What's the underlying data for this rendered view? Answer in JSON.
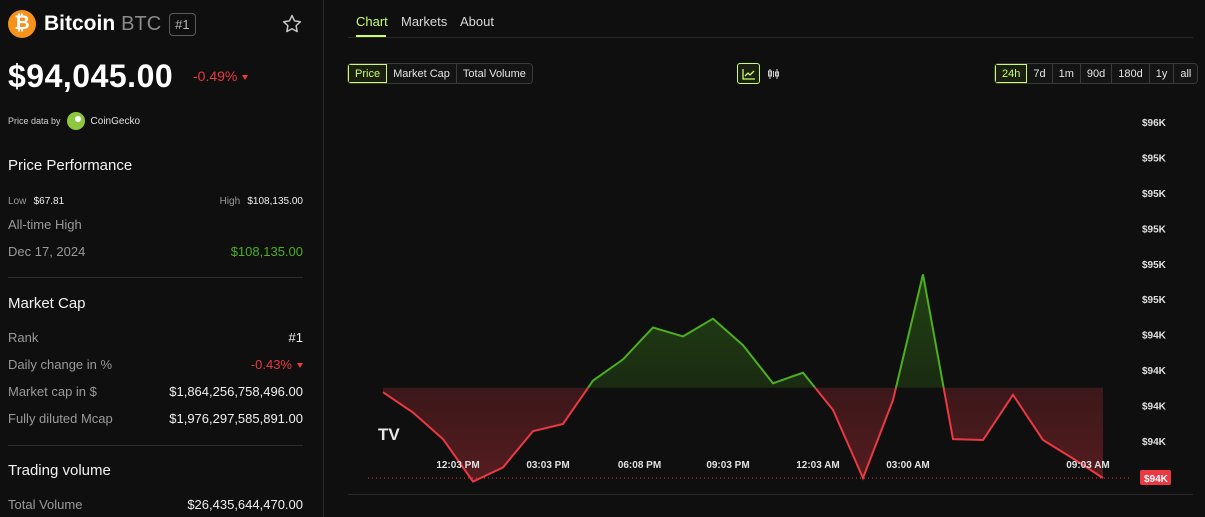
{
  "coin": {
    "logo_glyph": "₿",
    "name": "Bitcoin",
    "symbol": "BTC",
    "rank_badge": "#1",
    "price": "$94,045.00",
    "change": "-0.49%",
    "price_data_by": "Price data by",
    "source": "CoinGecko"
  },
  "performance": {
    "title": "Price Performance",
    "low_label": "Low",
    "low_value": "$67.81",
    "high_label": "High",
    "high_value": "$108,135.00",
    "ath_label": "All-time High",
    "ath_date": "Dec 17, 2024",
    "ath_value": "$108,135.00"
  },
  "market_cap": {
    "title": "Market Cap",
    "rows": [
      {
        "label": "Rank",
        "value": "#1"
      },
      {
        "label": "Daily change in %",
        "value": "-0.43%"
      },
      {
        "label": "Market cap in $",
        "value": "$1,864,256,758,496.00"
      },
      {
        "label": "Fully diluted Mcap",
        "value": "$1,976,297,585,891.00"
      }
    ]
  },
  "trading": {
    "title": "Trading volume",
    "rows": [
      {
        "label": "Total Volume",
        "value": "$26,435,644,470.00"
      }
    ]
  },
  "tabs": [
    "Chart",
    "Markets",
    "About"
  ],
  "metric_buttons": [
    "Price",
    "Market Cap",
    "Total Volume"
  ],
  "range_buttons": [
    "24h",
    "7d",
    "1m",
    "90d",
    "180d",
    "1y",
    "all"
  ],
  "chart_type_icons": [
    "line-chart-icon",
    "candlestick-icon"
  ],
  "colors": {
    "accent": "#c8ff6a",
    "up": "#4caf1f",
    "down": "#ea3943",
    "bitcoin": "#f7931a"
  },
  "chart_data": {
    "type": "line",
    "title": "",
    "xlabel": "",
    "ylabel": "",
    "baseline": 94400,
    "current_label": "$94K",
    "y_tick_labels": [
      "$96K",
      "$95K",
      "$95K",
      "$95K",
      "$95K",
      "$95K",
      "$94K",
      "$94K",
      "$94K",
      "$94K"
    ],
    "y_ticks": [
      95900,
      95700,
      95500,
      95300,
      95100,
      94900,
      94700,
      94500,
      94300,
      94100
    ],
    "ylim": [
      94020,
      95980
    ],
    "x_tick_labels": [
      "12:03 PM",
      "03:03 PM",
      "06:08 PM",
      "09:03 PM",
      "12:03 AM",
      "03:00 AM",
      "09:03 AM"
    ],
    "x_ticks": [
      3,
      6,
      9.05,
      12,
      15,
      18,
      24
    ],
    "xlim": [
      0,
      25.4
    ],
    "x": [
      0.5,
      1.5,
      2.5,
      3.5,
      4.5,
      5.5,
      6.5,
      7.5,
      8.5,
      9.5,
      10.5,
      11.5,
      12.5,
      13.5,
      14.5,
      15.5,
      16.5,
      17.5,
      18.5,
      19.5,
      20.5,
      21.5,
      22.5,
      23.5,
      24.5
    ],
    "values": [
      94375,
      94260,
      94110,
      93870,
      93950,
      94155,
      94195,
      94440,
      94560,
      94740,
      94690,
      94790,
      94640,
      94425,
      94485,
      94275,
      93890,
      94330,
      95040,
      94110,
      94105,
      94360,
      94105,
      94000,
      93890
    ],
    "watermark": "TV"
  }
}
